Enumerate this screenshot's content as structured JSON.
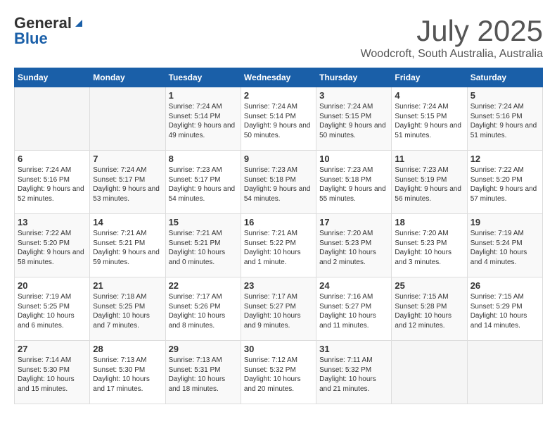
{
  "header": {
    "logo_general": "General",
    "logo_blue": "Blue",
    "month_title": "July 2025",
    "location": "Woodcroft, South Australia, Australia"
  },
  "days_of_week": [
    "Sunday",
    "Monday",
    "Tuesday",
    "Wednesday",
    "Thursday",
    "Friday",
    "Saturday"
  ],
  "weeks": [
    [
      {
        "day": "",
        "info": ""
      },
      {
        "day": "",
        "info": ""
      },
      {
        "day": "1",
        "info": "Sunrise: 7:24 AM\nSunset: 5:14 PM\nDaylight: 9 hours and 49 minutes."
      },
      {
        "day": "2",
        "info": "Sunrise: 7:24 AM\nSunset: 5:14 PM\nDaylight: 9 hours and 50 minutes."
      },
      {
        "day": "3",
        "info": "Sunrise: 7:24 AM\nSunset: 5:15 PM\nDaylight: 9 hours and 50 minutes."
      },
      {
        "day": "4",
        "info": "Sunrise: 7:24 AM\nSunset: 5:15 PM\nDaylight: 9 hours and 51 minutes."
      },
      {
        "day": "5",
        "info": "Sunrise: 7:24 AM\nSunset: 5:16 PM\nDaylight: 9 hours and 51 minutes."
      }
    ],
    [
      {
        "day": "6",
        "info": "Sunrise: 7:24 AM\nSunset: 5:16 PM\nDaylight: 9 hours and 52 minutes."
      },
      {
        "day": "7",
        "info": "Sunrise: 7:24 AM\nSunset: 5:17 PM\nDaylight: 9 hours and 53 minutes."
      },
      {
        "day": "8",
        "info": "Sunrise: 7:23 AM\nSunset: 5:17 PM\nDaylight: 9 hours and 54 minutes."
      },
      {
        "day": "9",
        "info": "Sunrise: 7:23 AM\nSunset: 5:18 PM\nDaylight: 9 hours and 54 minutes."
      },
      {
        "day": "10",
        "info": "Sunrise: 7:23 AM\nSunset: 5:18 PM\nDaylight: 9 hours and 55 minutes."
      },
      {
        "day": "11",
        "info": "Sunrise: 7:23 AM\nSunset: 5:19 PM\nDaylight: 9 hours and 56 minutes."
      },
      {
        "day": "12",
        "info": "Sunrise: 7:22 AM\nSunset: 5:20 PM\nDaylight: 9 hours and 57 minutes."
      }
    ],
    [
      {
        "day": "13",
        "info": "Sunrise: 7:22 AM\nSunset: 5:20 PM\nDaylight: 9 hours and 58 minutes."
      },
      {
        "day": "14",
        "info": "Sunrise: 7:21 AM\nSunset: 5:21 PM\nDaylight: 9 hours and 59 minutes."
      },
      {
        "day": "15",
        "info": "Sunrise: 7:21 AM\nSunset: 5:21 PM\nDaylight: 10 hours and 0 minutes."
      },
      {
        "day": "16",
        "info": "Sunrise: 7:21 AM\nSunset: 5:22 PM\nDaylight: 10 hours and 1 minute."
      },
      {
        "day": "17",
        "info": "Sunrise: 7:20 AM\nSunset: 5:23 PM\nDaylight: 10 hours and 2 minutes."
      },
      {
        "day": "18",
        "info": "Sunrise: 7:20 AM\nSunset: 5:23 PM\nDaylight: 10 hours and 3 minutes."
      },
      {
        "day": "19",
        "info": "Sunrise: 7:19 AM\nSunset: 5:24 PM\nDaylight: 10 hours and 4 minutes."
      }
    ],
    [
      {
        "day": "20",
        "info": "Sunrise: 7:19 AM\nSunset: 5:25 PM\nDaylight: 10 hours and 6 minutes."
      },
      {
        "day": "21",
        "info": "Sunrise: 7:18 AM\nSunset: 5:25 PM\nDaylight: 10 hours and 7 minutes."
      },
      {
        "day": "22",
        "info": "Sunrise: 7:17 AM\nSunset: 5:26 PM\nDaylight: 10 hours and 8 minutes."
      },
      {
        "day": "23",
        "info": "Sunrise: 7:17 AM\nSunset: 5:27 PM\nDaylight: 10 hours and 9 minutes."
      },
      {
        "day": "24",
        "info": "Sunrise: 7:16 AM\nSunset: 5:27 PM\nDaylight: 10 hours and 11 minutes."
      },
      {
        "day": "25",
        "info": "Sunrise: 7:15 AM\nSunset: 5:28 PM\nDaylight: 10 hours and 12 minutes."
      },
      {
        "day": "26",
        "info": "Sunrise: 7:15 AM\nSunset: 5:29 PM\nDaylight: 10 hours and 14 minutes."
      }
    ],
    [
      {
        "day": "27",
        "info": "Sunrise: 7:14 AM\nSunset: 5:30 PM\nDaylight: 10 hours and 15 minutes."
      },
      {
        "day": "28",
        "info": "Sunrise: 7:13 AM\nSunset: 5:30 PM\nDaylight: 10 hours and 17 minutes."
      },
      {
        "day": "29",
        "info": "Sunrise: 7:13 AM\nSunset: 5:31 PM\nDaylight: 10 hours and 18 minutes."
      },
      {
        "day": "30",
        "info": "Sunrise: 7:12 AM\nSunset: 5:32 PM\nDaylight: 10 hours and 20 minutes."
      },
      {
        "day": "31",
        "info": "Sunrise: 7:11 AM\nSunset: 5:32 PM\nDaylight: 10 hours and 21 minutes."
      },
      {
        "day": "",
        "info": ""
      },
      {
        "day": "",
        "info": ""
      }
    ]
  ]
}
